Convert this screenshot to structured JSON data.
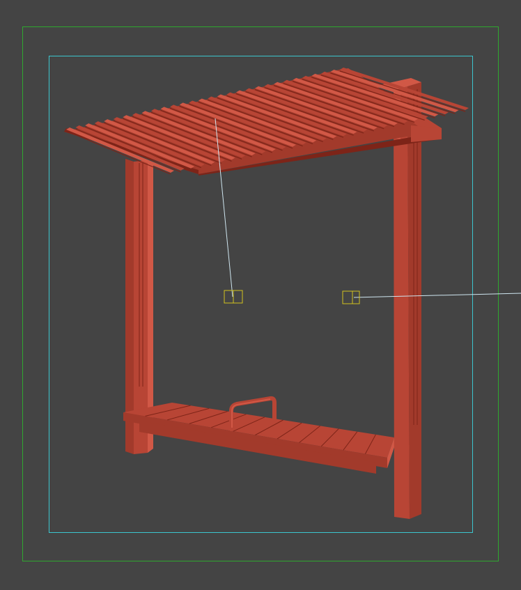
{
  "viewport": {
    "background": "#444444",
    "safe_frame_outer_color": "#2fa82f",
    "safe_frame_inner_color": "#3cc6cf"
  },
  "model": {
    "color": "#b84535",
    "color_light": "#d15846",
    "color_dark": "#7d2418",
    "color_mid": "#a23a2b"
  },
  "helpers": {
    "target_color": "#d2c21e",
    "link_color": "#cfe6f0"
  }
}
